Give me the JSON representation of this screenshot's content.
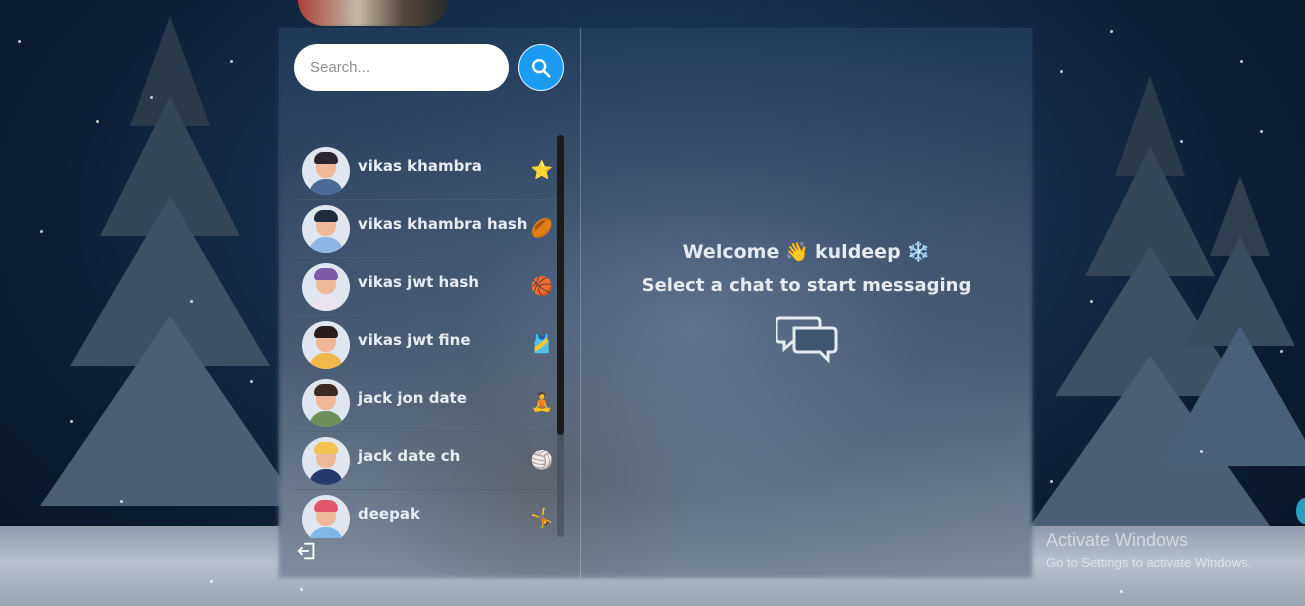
{
  "search": {
    "placeholder": "Search..."
  },
  "chats": [
    {
      "name": "vikas khambra",
      "emoji": "⭐",
      "emoji_name": "star-icon",
      "body": "#4a6b96",
      "hair": "#2a2530"
    },
    {
      "name": "vikas khambra hash",
      "emoji": "🏉",
      "emoji_name": "rugby-ball-icon",
      "body": "#8fb7e6",
      "hair": "#1f2a3a"
    },
    {
      "name": "vikas jwt hash",
      "emoji": "🏀",
      "emoji_name": "basketball-icon",
      "body": "#e9e4ef",
      "hair": "#7b5aa6"
    },
    {
      "name": "vikas jwt fine",
      "emoji": "🎽",
      "emoji_name": "running-shirt-icon",
      "body": "#f2b94a",
      "hair": "#2a1d1b"
    },
    {
      "name": "jack jon date",
      "emoji": "🧘",
      "emoji_name": "meditation-icon",
      "body": "#6f8f5a",
      "hair": "#3a2a20"
    },
    {
      "name": "jack date ch",
      "emoji": "🏐",
      "emoji_name": "volleyball-icon",
      "body": "#233a6b",
      "hair": "#f2c14e"
    },
    {
      "name": "deepak",
      "emoji": "🤸",
      "emoji_name": "cartwheel-icon",
      "body": "#7fb8e8",
      "hair": "#e0566a"
    }
  ],
  "welcome": {
    "text": "Welcome",
    "wave": "👋",
    "user": "kuldeep",
    "snow": "❄️"
  },
  "subtitle": "Select a chat to start messaging",
  "watermark": {
    "line1": "Activate Windows",
    "line2": "Go to Settings to activate Windows."
  },
  "colors": {
    "accent": "#1d9bf0"
  }
}
